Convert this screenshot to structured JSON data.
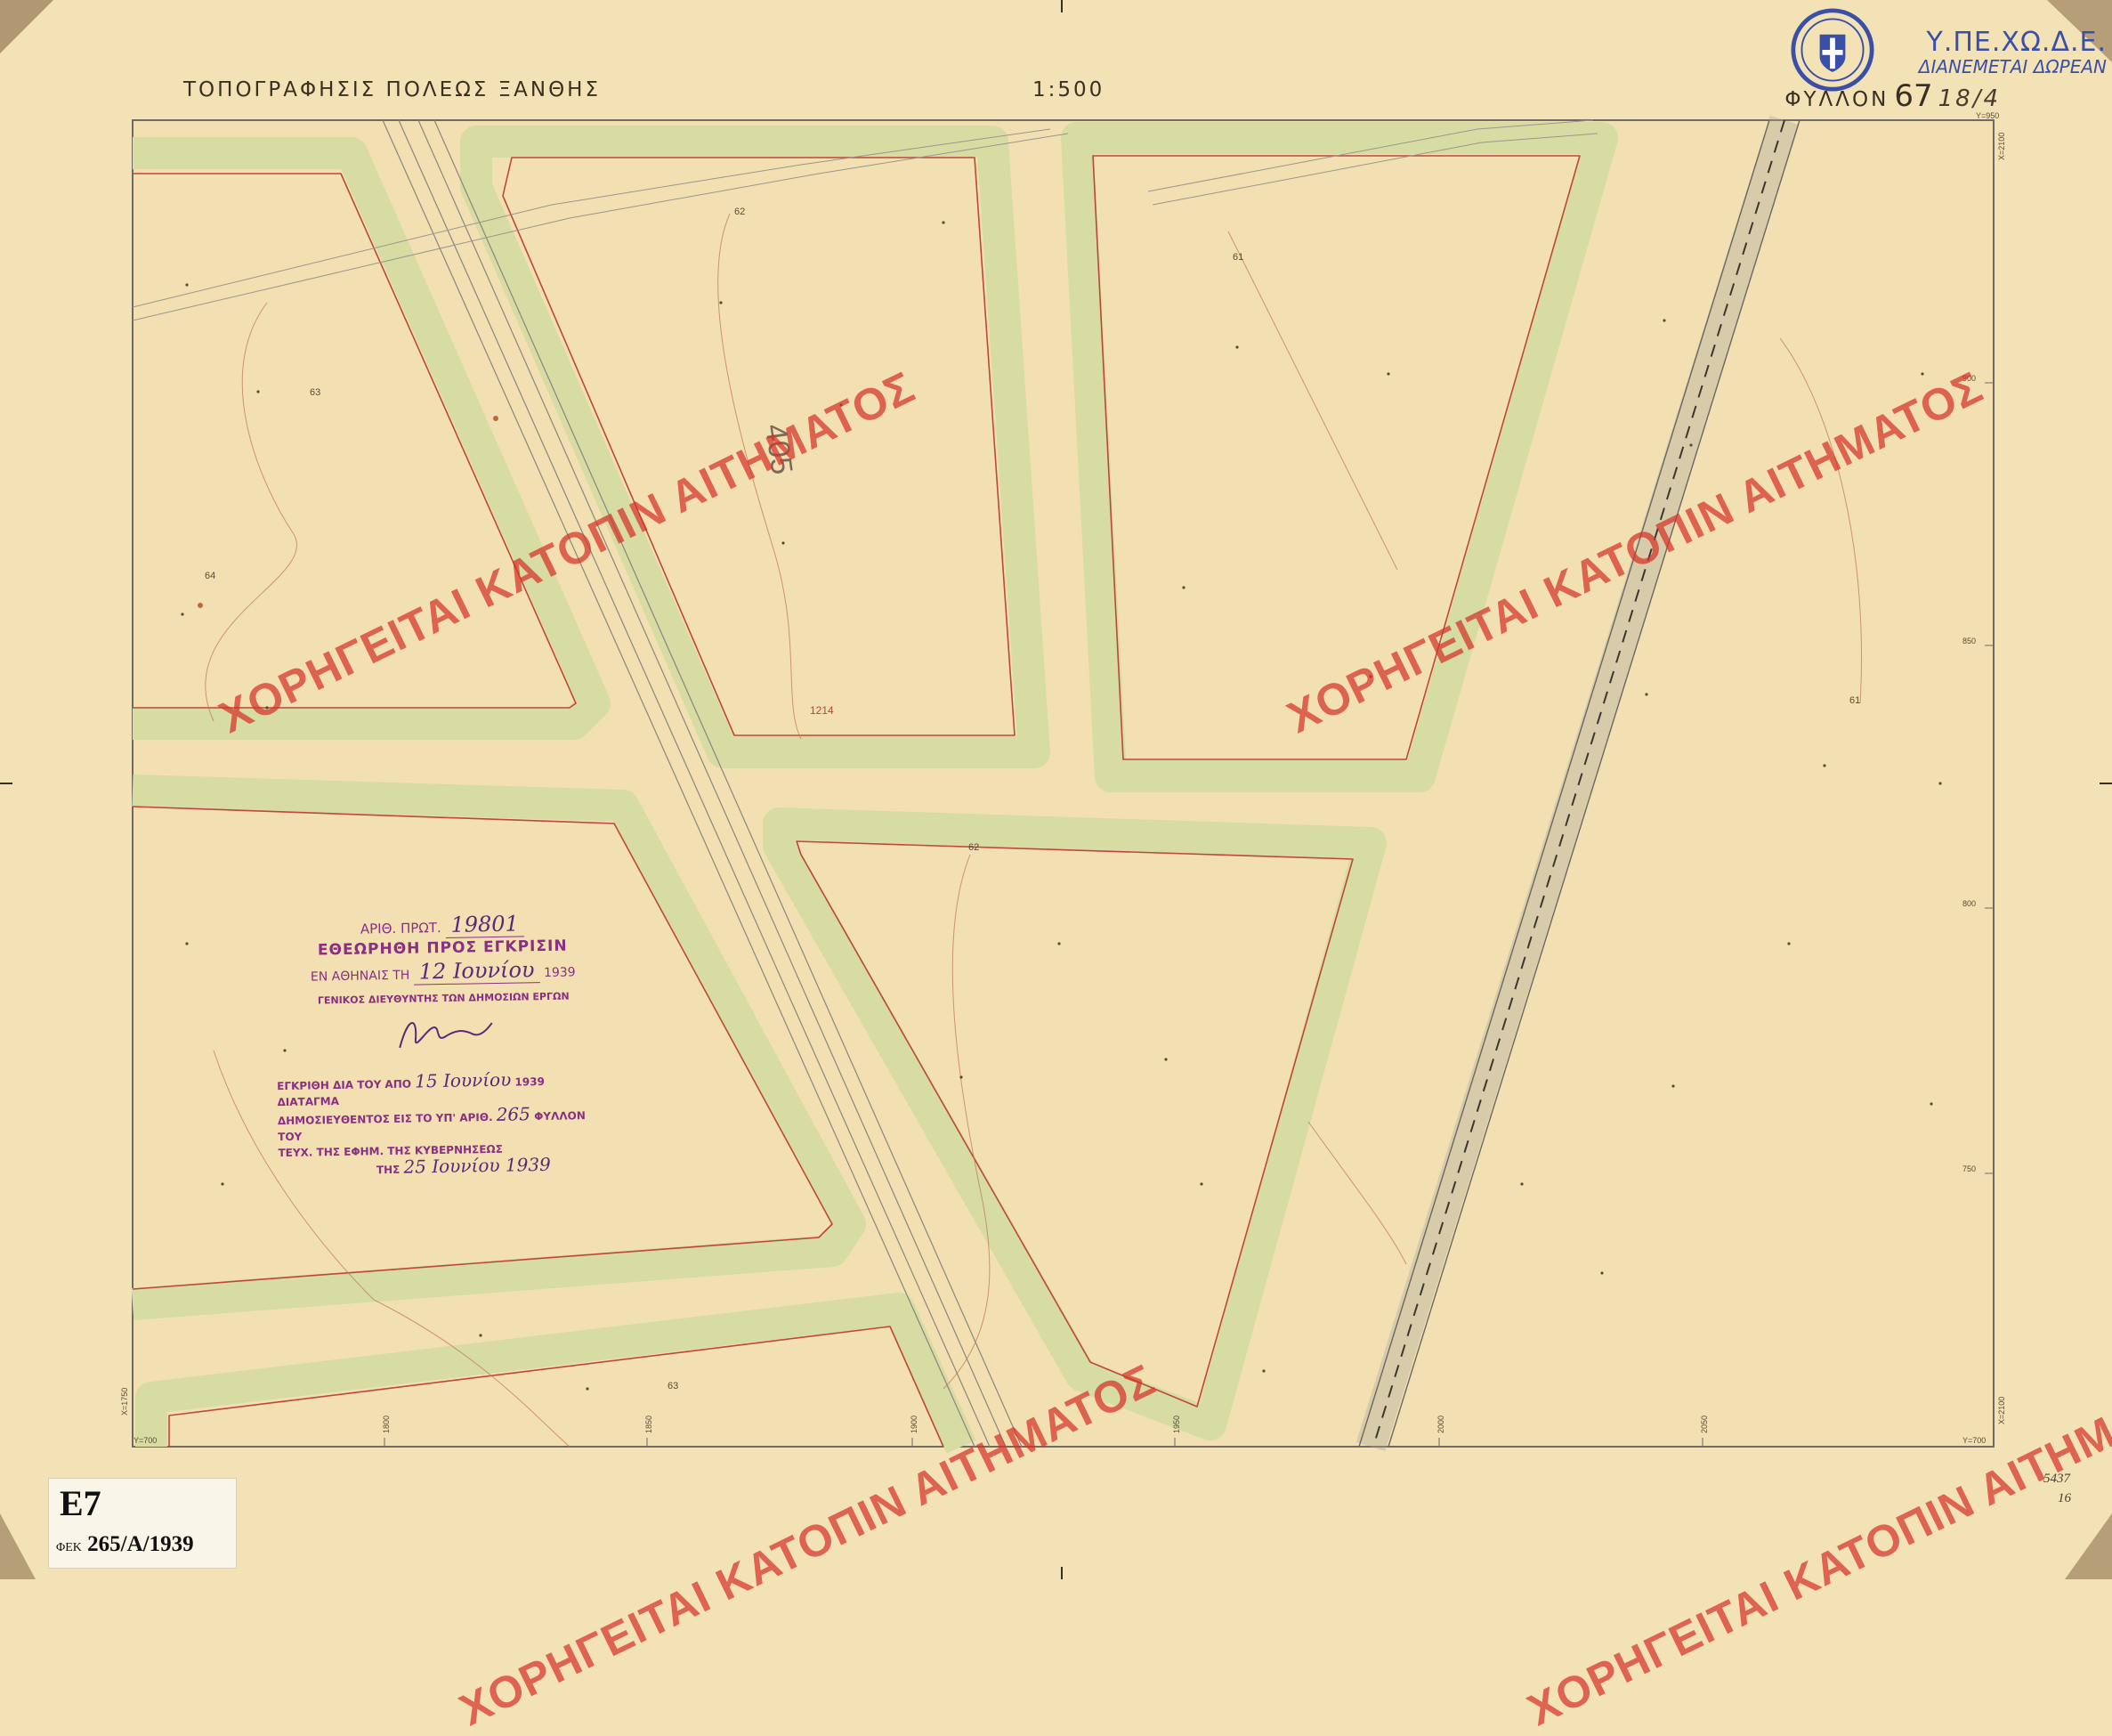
{
  "header": {
    "title": "ΤΟΠΟΓΡΑΦΗΣΙΣ ΠΟΛΕΩΣ ΞΑΝΘΗΣ",
    "scale": "1:500",
    "sheet_label": "ΦΥΛΛΟΝ",
    "sheet_number": "67",
    "sheet_handwritten": "18/4"
  },
  "agency": {
    "name": "Υ.ΠΕ.ΧΩ.Δ.Ε.",
    "subtitle": "ΔΙΑΝΕΜΕΤΑΙ ΔΩΡΕΑΝ"
  },
  "watermark": "ΧΟΡΗΓΕΙΤΑΙ ΚΑΤΟΠΙΝ ΑΙΤΗΜΑΤΟΣ",
  "approval_stamp": {
    "protocol_label": "ΑΡΙΘ. ΠΡΩΤ.",
    "protocol_number": "19801",
    "line2": "ΕΘΕΩΡΗΘΗ ΠΡΟΣ ΕΓΚΡΙΣΙΝ",
    "line3_prefix": "ΕΝ ΑΘΗΝΑΙΣ ΤΗ",
    "line3_date": "12 Ιουνίου",
    "line3_year": "1939",
    "line4": "ΓΕΝΙΚΟΣ ΔΙΕΥΘΥΝΤΗΣ ΤΩΝ ΔΗΜΟΣΙΩΝ ΕΡΓΩΝ"
  },
  "decree_stamp": {
    "line1_prefix": "ΕΓΚΡΙΘΗ ΔΙΑ ΤΟΥ ΑΠΟ",
    "line1_date": "15 Ιουνίου",
    "line1_suffix": "1939 ΔΙΑΤΑΓΜΑ",
    "line2_prefix": "ΔΗΜΟΣΙΕΥΘΕΝΤΟΣ ΕΙΣ ΤΟ ΥΠ' ΑΡΙΘ.",
    "line2_number": "265",
    "line2_suffix": "ΦΥΛΛΟΝ ΤΟΥ",
    "line3": "ΤΕΥΧ. ΤΗΣ ΕΦΗΜ. ΤΗΣ ΚΥΒΕΡΝΗΣΕΩΣ",
    "line4_prefix": "ΤΗΣ",
    "line4_date": "25 Ιουνίου 1939"
  },
  "gazette": {
    "code": "E7",
    "prefix": "ΦΕΚ",
    "reference": "265/A/1939"
  },
  "archive_note": {
    "number": "5437",
    "sub": "16"
  },
  "map_labels": {
    "block_number": "405",
    "benchmark": "1214",
    "contour_labels": [
      "63",
      "64",
      "62",
      "61",
      "62",
      "63",
      "61"
    ],
    "grid_y_top": "Y=950",
    "grid_y_bottom_left": "Y=700",
    "grid_y_bottom_right": "Y=700",
    "grid_x_right_top": "X=2100",
    "grid_x_right_bottom": "X=2100",
    "grid_x_left_bottom": "X=1750",
    "right_ticks": [
      "900",
      "850",
      "800",
      "750"
    ],
    "bottom_ticks": [
      "1800",
      "1850",
      "1900",
      "1950",
      "2000",
      "2050"
    ]
  },
  "colors": {
    "paper": "#f3e2b6",
    "street_fill": "#d6dca2",
    "block_edge": "#c0463c",
    "frame": "#6f6a64",
    "watermark": "#d63228",
    "stamp": "#8a2f83",
    "railway": "#8a8680"
  }
}
